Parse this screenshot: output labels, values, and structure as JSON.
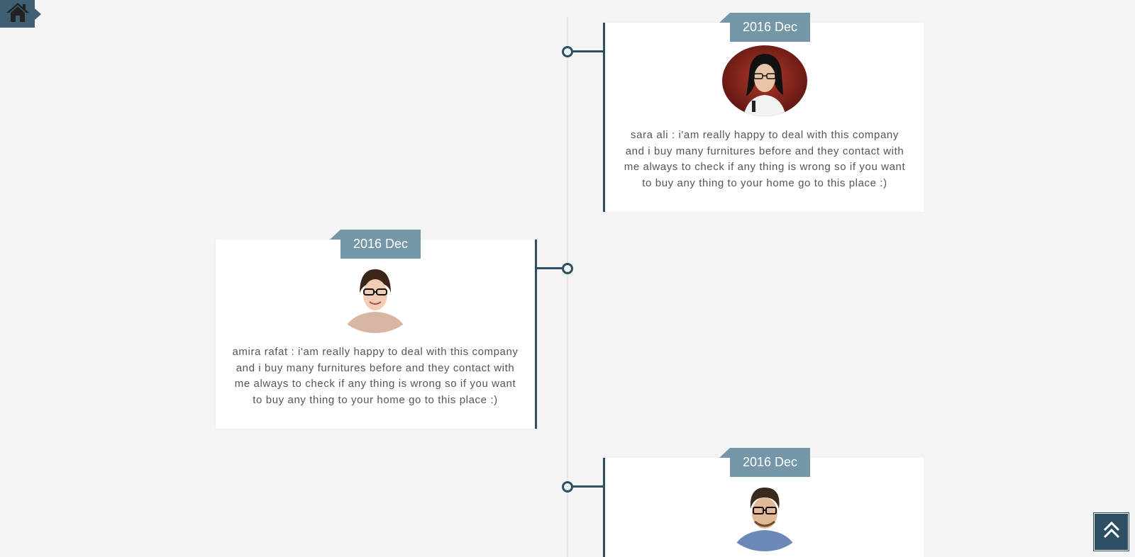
{
  "nav": {
    "home_icon": "home-icon",
    "top_icon": "double-chevron-up-icon"
  },
  "timeline": {
    "items": [
      {
        "date": "2016 Dec",
        "quote": "sara ali : i'am really happy to deal with this company and i buy many furnitures before and they contact with me always to check if any thing is wrong so if you want to buy any thing to your home go to this place :)",
        "side": "right"
      },
      {
        "date": "2016 Dec",
        "quote": "amira rafat : i'am really happy to deal with this company and i buy many furnitures before and they contact with me always to check if any thing is wrong so if you want to buy any thing to your home go to this place :)",
        "side": "left"
      },
      {
        "date": "2016 Dec",
        "quote": "",
        "side": "right"
      }
    ]
  },
  "colors": {
    "background": "#f4f4f4",
    "accent_dark": "#2c4f63",
    "date_tag": "#7497a7",
    "home_button": "#3f5f73"
  }
}
